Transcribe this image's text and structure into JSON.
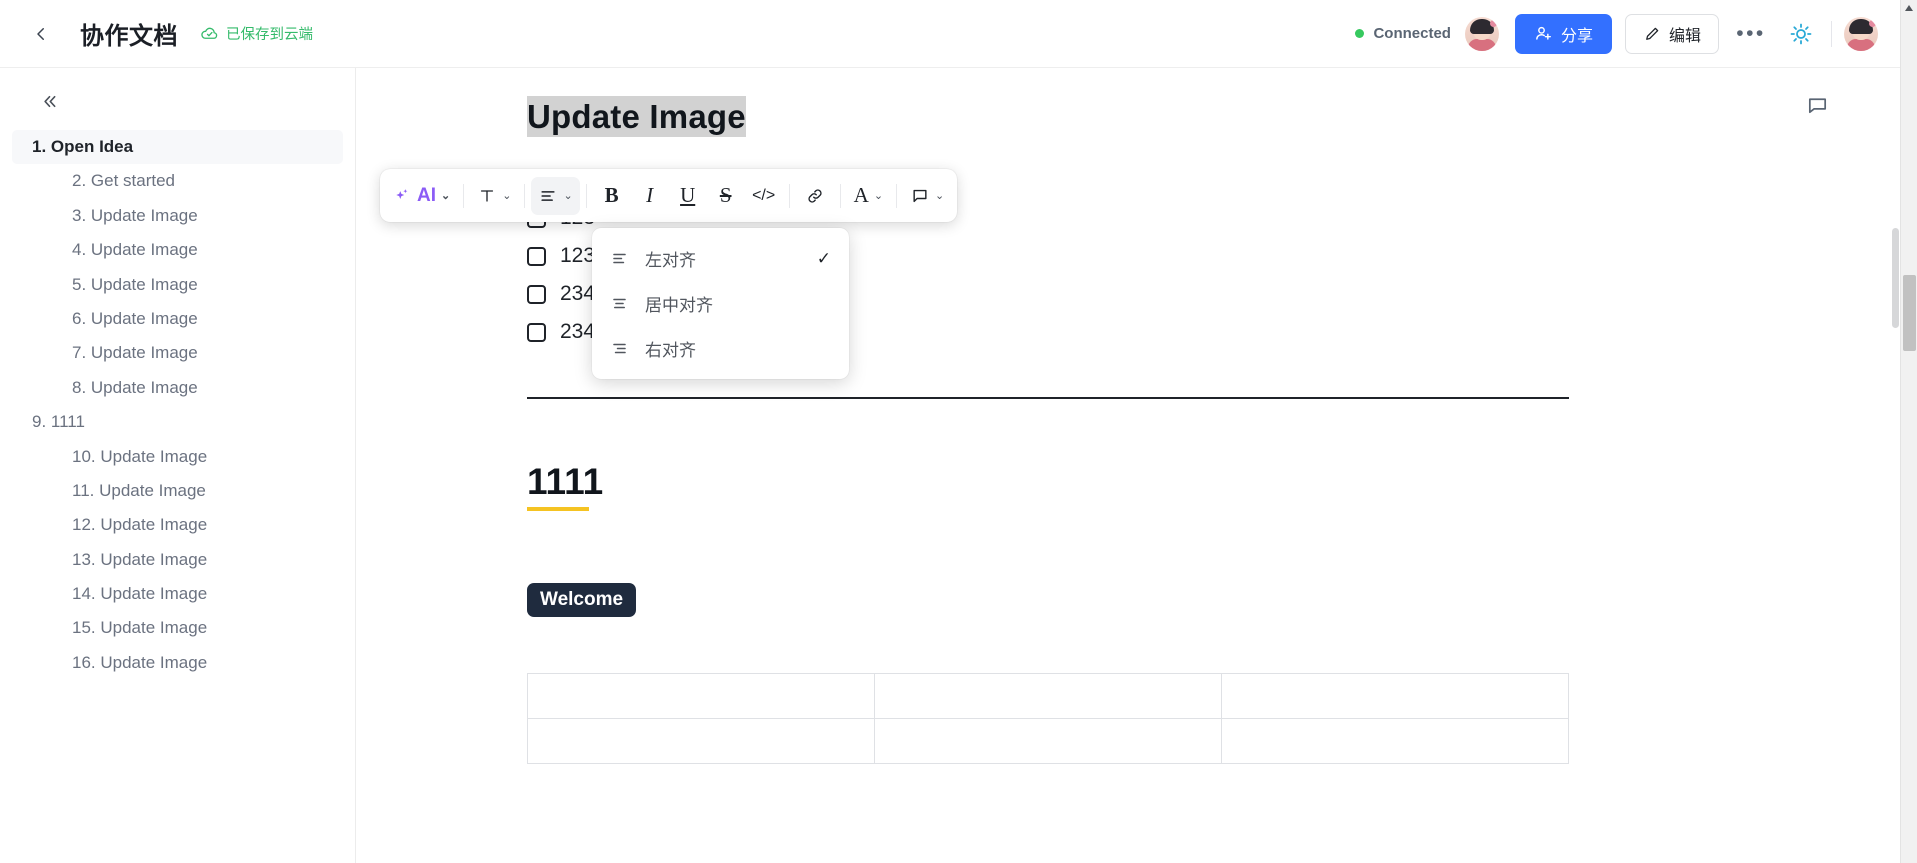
{
  "header": {
    "back_icon": "chevron-left-icon",
    "title": "协作文档",
    "save_icon": "cloud-check-icon",
    "save_status": "已保存到云端",
    "connection_label": "Connected",
    "connection_color": "#36c95f",
    "share_icon": "share-person-icon",
    "share_label": "分享",
    "edit_icon": "pencil-icon",
    "edit_label": "编辑",
    "more_icon": "more-horizontal-icon",
    "theme_icon": "sun-brightness-icon",
    "avatar_icon": "user-avatar",
    "accent_color": "#3370ff"
  },
  "sidebar": {
    "collapse_icon": "double-chevron-left-icon",
    "items": [
      {
        "label": "1. Open Idea",
        "level": 1,
        "active": true
      },
      {
        "label": "2. Get started",
        "level": 2,
        "active": false
      },
      {
        "label": "3. Update Image",
        "level": 2,
        "active": false
      },
      {
        "label": "4. Update Image",
        "level": 2,
        "active": false
      },
      {
        "label": "5. Update Image",
        "level": 2,
        "active": false
      },
      {
        "label": "6. Update Image",
        "level": 2,
        "active": false
      },
      {
        "label": "7. Update Image",
        "level": 2,
        "active": false
      },
      {
        "label": "8. Update Image",
        "level": 2,
        "active": false
      },
      {
        "label": "9. 1111",
        "level": 1,
        "active": false
      },
      {
        "label": "10. Update Image",
        "level": 2,
        "active": false
      },
      {
        "label": "11. Update Image",
        "level": 2,
        "active": false
      },
      {
        "label": "12. Update Image",
        "level": 2,
        "active": false
      },
      {
        "label": "13. Update Image",
        "level": 2,
        "active": false
      },
      {
        "label": "14. Update Image",
        "level": 2,
        "active": false
      },
      {
        "label": "15. Update Image",
        "level": 2,
        "active": false
      },
      {
        "label": "16. Update Image",
        "level": 2,
        "active": false
      }
    ]
  },
  "toolbar": {
    "ai_icon": "ai-sparkle-icon",
    "ai_label": "AI",
    "text_style_icon": "text-style-T-icon",
    "align_icon": "align-left-icon",
    "bold_label": "B",
    "italic_label": "I",
    "underline_label": "U",
    "strikethrough_label": "S",
    "code_label": "</>",
    "link_icon": "link-icon",
    "font_color_label": "A",
    "comment_icon": "comment-icon",
    "chevron": "⌄"
  },
  "align_menu": {
    "items": [
      {
        "icon": "align-left-icon",
        "label": "左对齐",
        "checked": true
      },
      {
        "icon": "align-center-icon",
        "label": "居中对齐",
        "checked": false
      },
      {
        "icon": "align-right-icon",
        "label": "右对齐",
        "checked": false
      }
    ],
    "check_glyph": "✓"
  },
  "document": {
    "comment_icon": "comment-bubble-icon",
    "heading_selected": "Update Image",
    "todos": [
      {
        "text": "123",
        "checked": false
      },
      {
        "text": "123",
        "checked": false
      },
      {
        "text": "234",
        "checked": false
      },
      {
        "text": "234234234234",
        "checked": false
      }
    ],
    "heading_1111": "1111",
    "heading_1111_underline_color": "#f5c322",
    "welcome_badge": "Welcome",
    "welcome_badge_bg": "#1f2b3e",
    "table": {
      "rows": 2,
      "cols": 3,
      "cells": [
        [
          "",
          "",
          ""
        ],
        [
          "",
          "",
          ""
        ]
      ]
    }
  }
}
